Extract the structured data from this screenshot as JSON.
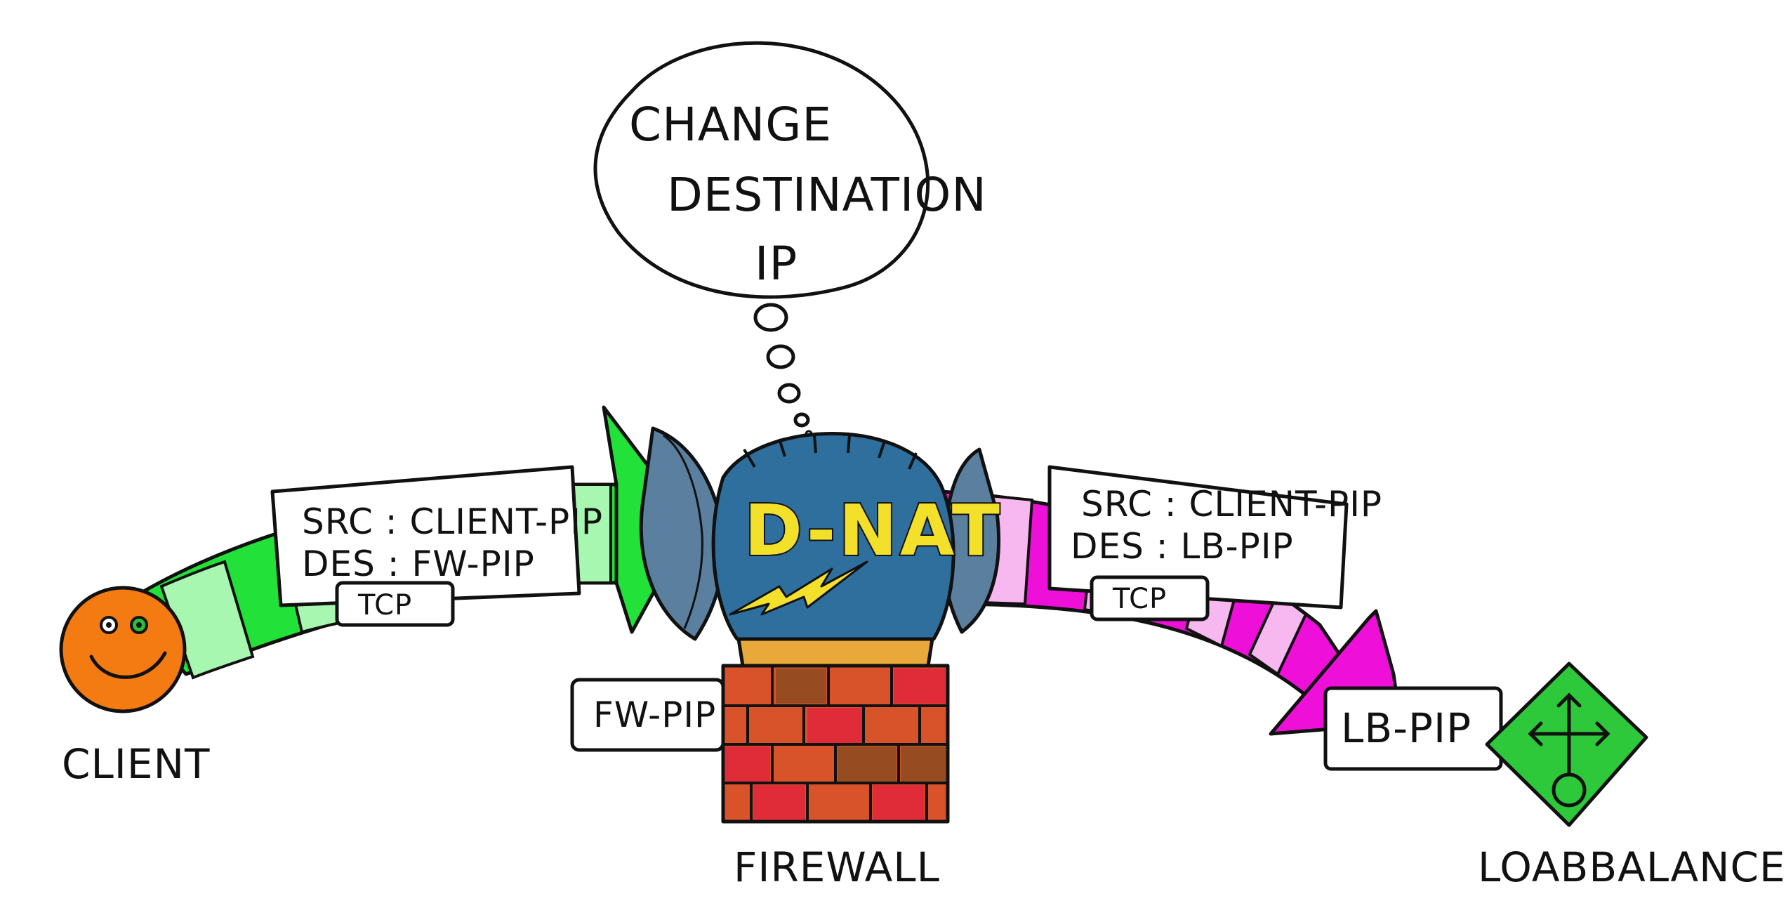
{
  "thought_bubble": {
    "lines": [
      "CHANGE",
      "DESTINATION",
      "IP"
    ]
  },
  "firewall": {
    "badge": "D-NAT",
    "label": "FIREWALL",
    "ip_tag": "FW-PIP"
  },
  "client": {
    "label": "CLIENT"
  },
  "loadbalancer": {
    "label": "LOABBALANCER",
    "ip_tag": "LB-PIP"
  },
  "packet_in": {
    "src": "SRC : CLIENT-PIP",
    "des": "DES : FW-PIP",
    "protocol": "TCP"
  },
  "packet_out": {
    "src": "SRC : CLIENT-PIP",
    "des": "DES : LB-PIP",
    "protocol": "TCP"
  },
  "colors": {
    "client": "#f47a12",
    "arrow_in": "#22e23a",
    "arrow_in_light": "#a8f7b0",
    "arrow_out": "#ee10d8",
    "arrow_out_light": "#f7b8ef",
    "firewall_head": "#2f6f9e",
    "bricks": "#d9532a",
    "loadbalancer": "#2ec93a"
  }
}
